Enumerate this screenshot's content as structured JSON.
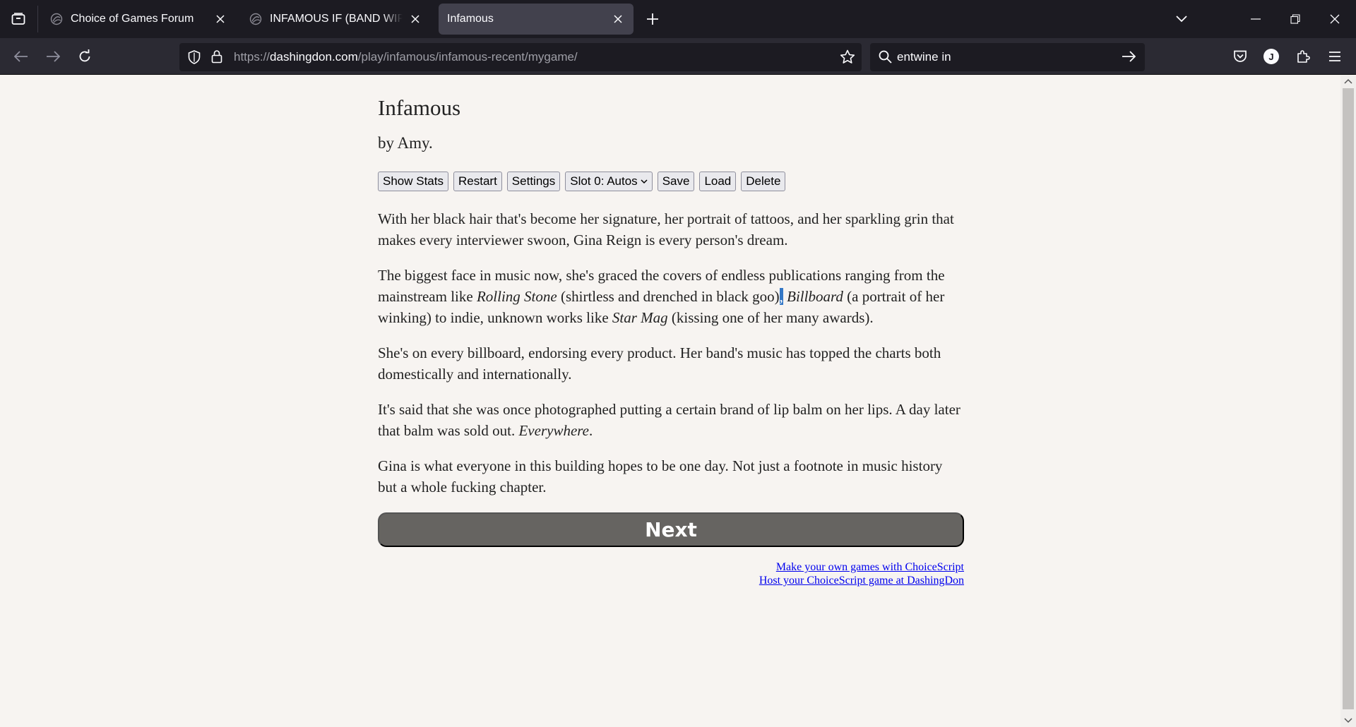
{
  "browser": {
    "tabs": [
      {
        "title": "Choice of Games Forum",
        "favicon": "choice-of-games-icon",
        "active": false
      },
      {
        "title": "INFAMOUS IF (BAND WIP) CHAPTER",
        "favicon": "choice-of-games-icon",
        "active": false
      },
      {
        "title": "Infamous",
        "favicon": "",
        "active": true
      }
    ],
    "url_prefix": "https://",
    "url_domain": "dashingdon.com",
    "url_path": "/play/infamous/infamous-recent/mygame/",
    "search_text": "entwine in",
    "account_initial": "J"
  },
  "game": {
    "title": "Infamous",
    "author": "by Amy.",
    "buttons": {
      "show_stats": "Show Stats",
      "restart": "Restart",
      "settings": "Settings",
      "slot": "Slot 0: Autos",
      "save": "Save",
      "load": "Load",
      "delete": "Delete"
    },
    "paragraphs": {
      "p1": "With her black hair that's become her signature, her portrait of tattoos, and her sparkling grin that makes every interviewer swoon, Gina Reign is every person's dream.",
      "p2_a": "The biggest face in music now, she's graced the covers of endless publications ranging from the mainstream like ",
      "p2_b": "Rolling Stone",
      "p2_c": " (shirtless and drenched in black goo)",
      "p2_d": ",",
      "p2_e": " ",
      "p2_f": "Billboard",
      "p2_g": " (a portrait of her winking) to indie, unknown works like ",
      "p2_h": "Star Mag",
      "p2_i": " (kissing one of her many awards).",
      "p3": "She's on every billboard, endorsing every product. Her band's music has topped the charts both domestically and internationally.",
      "p4_a": "It's said that she was once photographed putting a certain brand of lip balm on her lips. A day later that balm was sold out. ",
      "p4_b": "Everywhere",
      "p4_c": ".",
      "p5": "Gina is what everyone in this building hopes to be one day. Not just a footnote in music history but a whole fucking chapter."
    },
    "next_label": "Next",
    "footer": {
      "link1": "Make your own games with ChoiceScript",
      "link2": "Host your ChoiceScript game at DashingDon"
    }
  }
}
